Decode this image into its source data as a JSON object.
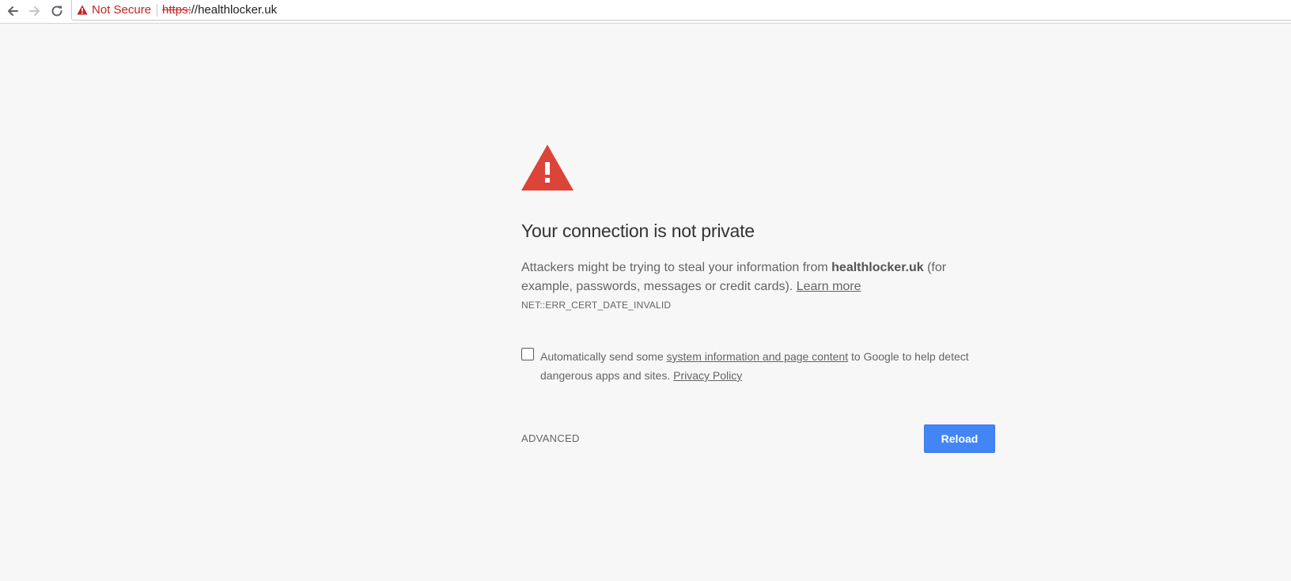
{
  "browser": {
    "security_label": "Not Secure",
    "url_scheme": "https:",
    "url_rest": "//healthlocker.uk",
    "icons": {
      "back": "back-arrow-icon",
      "forward": "forward-arrow-icon",
      "reload": "reload-icon",
      "security": "warning-triangle-icon"
    }
  },
  "interstitial": {
    "icon": "warning-triangle-icon",
    "heading": "Your connection is not private",
    "explanation_prefix": "Attackers might be trying to steal your information from ",
    "domain": "healthlocker.uk",
    "explanation_suffix": " (for example, passwords, messages or credit cards).",
    "learn_more": "Learn more",
    "error_code": "NET::ERR_CERT_DATE_INVALID",
    "opt_in": {
      "prefix": "Automatically send some ",
      "link": "system information and page content",
      "middle": " to Google to help detect dangerous apps and sites.",
      "privacy_link": "Privacy Policy",
      "checked": false
    },
    "advanced_label": "ADVANCED",
    "reload_label": "Reload"
  },
  "colors": {
    "page_background": "#f7f7f7",
    "danger_red": "#db4437",
    "security_red": "#c5221f",
    "button_blue": "#4285f4",
    "text_gray": "#646464",
    "heading_text": "#333333"
  }
}
